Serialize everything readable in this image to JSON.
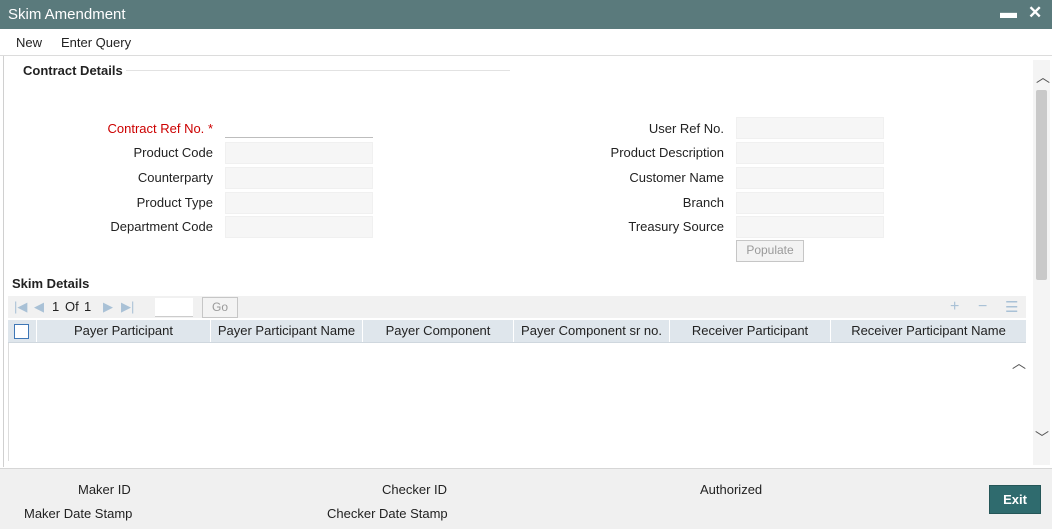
{
  "window": {
    "title": "Skim Amendment",
    "minimize_glyph": "▬",
    "close_glyph": "✕"
  },
  "menu": {
    "items": [
      "New",
      "Enter Query"
    ]
  },
  "contract_details": {
    "title": "Contract Details",
    "left_fields": [
      {
        "label": "Contract Ref No.",
        "required": true,
        "value": ""
      },
      {
        "label": "Product Code",
        "value": ""
      },
      {
        "label": "Counterparty",
        "value": ""
      },
      {
        "label": "Product Type",
        "value": ""
      },
      {
        "label": "Department Code",
        "value": ""
      }
    ],
    "right_fields": [
      {
        "label": "User Ref No.",
        "value": ""
      },
      {
        "label": "Product Description",
        "value": ""
      },
      {
        "label": "Customer Name",
        "value": ""
      },
      {
        "label": "Branch",
        "value": ""
      },
      {
        "label": "Treasury Source",
        "value": ""
      }
    ],
    "required_marker": "*",
    "populate_label": "Populate"
  },
  "skim_details": {
    "title": "Skim Details",
    "pager": {
      "current": "1",
      "of_label": "Of",
      "total": "1",
      "go_label": "Go"
    },
    "columns": [
      "Payer Participant",
      "Payer Participant Name",
      "Payer Component",
      "Payer Component sr no.",
      "Receiver Participant",
      "Receiver Participant Name"
    ],
    "rows": []
  },
  "footer": {
    "maker_id": "Maker ID",
    "maker_date_stamp": "Maker Date Stamp",
    "checker_id": "Checker ID",
    "checker_date_stamp": "Checker Date Stamp",
    "authorized": "Authorized",
    "exit_label": "Exit"
  },
  "colors": {
    "titlebar": "#5a7a7c",
    "required_label": "#cc0000",
    "grid_header": "#dfe6ec",
    "exit_button": "#2f6b6e",
    "pager_icon": "#a9c1d6"
  }
}
